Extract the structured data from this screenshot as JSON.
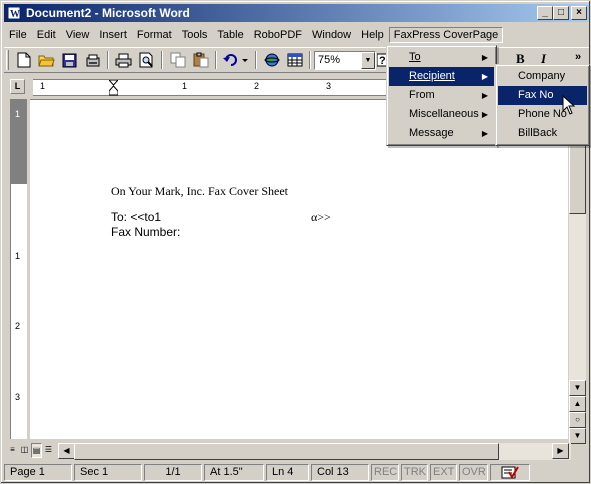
{
  "window": {
    "title": "Document2 - Microsoft Word",
    "controls": {
      "minimize": "_",
      "restore": "□",
      "close": "×"
    }
  },
  "menubar": {
    "items": [
      "File",
      "Edit",
      "View",
      "Insert",
      "Format",
      "Tools",
      "Table",
      "RoboPDF",
      "Window",
      "Help",
      "FaxPress CoverPage"
    ]
  },
  "toolbar": {
    "zoom": "75%",
    "icons": [
      "new-document-icon",
      "open-folder-icon",
      "save-icon",
      "permission-icon",
      "print-icon",
      "print-preview-icon",
      "copy-icon",
      "paste-icon",
      "undo-icon",
      "web-icon",
      "insert-table-icon"
    ],
    "bold": "B",
    "italic": "I",
    "more": "»"
  },
  "ruler": {
    "corner": "L",
    "numbers": [
      "1",
      "1",
      "2",
      "3"
    ],
    "vertical_numbers": [
      "1",
      "1",
      "2",
      "3"
    ]
  },
  "document": {
    "line1": "On Your Mark, Inc. Fax Cover Sheet",
    "to_label": "To: <<to1",
    "to_field_end": "α>>",
    "fax_label": "Fax Number:"
  },
  "faxpress_menu": {
    "items": [
      {
        "label": "To",
        "hotkey_index": 0
      },
      {
        "label": "Recipient",
        "hotkey_index": 0
      },
      {
        "label": "From",
        "hotkey_index": 0
      },
      {
        "label": "Miscellaneous",
        "hotkey_index": 0
      },
      {
        "label": "Message",
        "hotkey_index": 0
      }
    ],
    "highlighted": "Recipient"
  },
  "recipient_submenu": {
    "items": [
      "Company",
      "Fax No",
      "Phone No",
      "BillBack"
    ],
    "highlighted": "Fax No"
  },
  "statusbar": {
    "page": "Page  1",
    "section": "Sec  1",
    "pages": "1/1",
    "at": "At  1.5\"",
    "line": "Ln  4",
    "col": "Col  13",
    "rec": "REC",
    "trk": "TRK",
    "ext": "EXT",
    "ovr": "OVR"
  },
  "colors": {
    "title_start": "#0a246a",
    "title_end": "#a6caf0",
    "menu_highlight": "#0a246a",
    "face": "#d4d0c8"
  }
}
